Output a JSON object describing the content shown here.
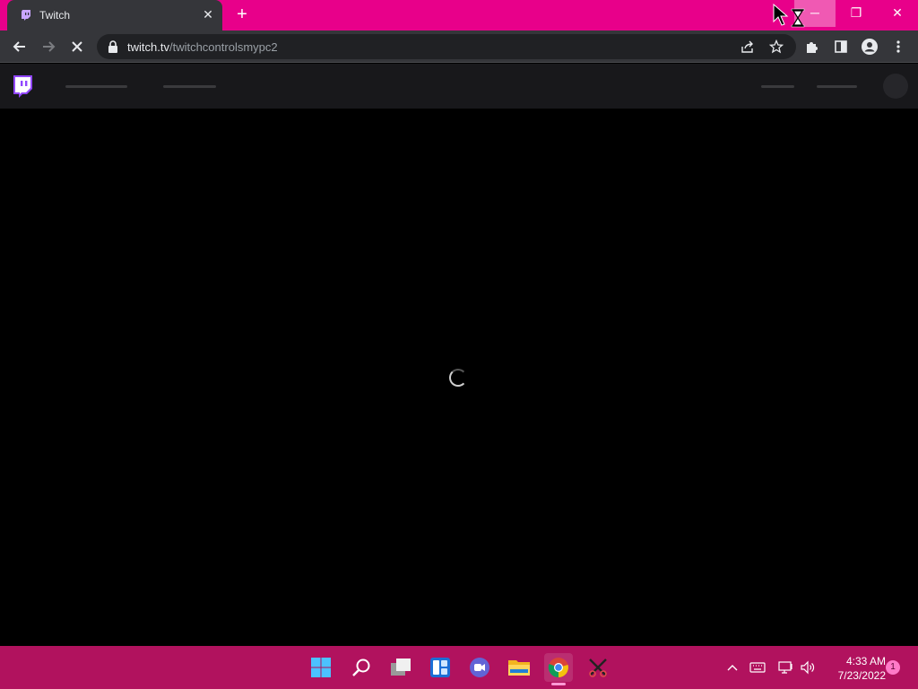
{
  "browser": {
    "tab": {
      "title": "Twitch",
      "close_glyph": "✕"
    },
    "new_tab_glyph": "+",
    "address": {
      "host": "twitch.tv",
      "path": "/twitchcontrolsmypc2"
    }
  },
  "window_controls": {
    "minimize": "─",
    "restore": "❐",
    "close": "✕"
  },
  "page": {
    "status": "loading"
  },
  "taskbar": {
    "pinned": [
      "start-icon",
      "search-icon",
      "task-view-icon",
      "widgets-icon",
      "teams-chat-icon",
      "file-explorer-icon",
      "chrome-icon",
      "snipping-tool-icon"
    ],
    "tray": [
      "chevron-up-icon",
      "keyboard-icon",
      "network-icon",
      "volume-icon"
    ],
    "clock": {
      "time": "4:33 AM",
      "date": "7/23/2022"
    },
    "notification_count": "1"
  },
  "colors": {
    "titlebar": "#e8008a",
    "taskbar": "#b1125e",
    "twitch_purple": "#9146ff"
  }
}
